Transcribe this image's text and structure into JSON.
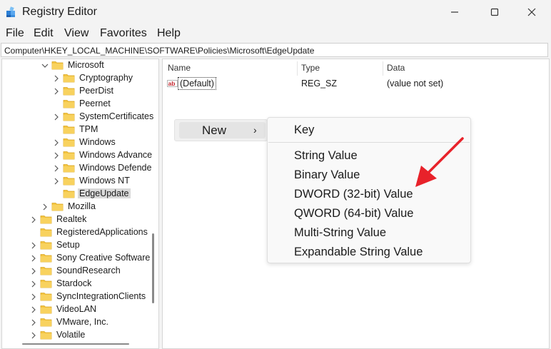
{
  "window": {
    "title": "Registry Editor",
    "icon": "registry-editor-icon"
  },
  "window_controls": {
    "minimize": "─",
    "maximize": "☐",
    "close": "✕"
  },
  "menubar": [
    "File",
    "Edit",
    "View",
    "Favorites",
    "Help"
  ],
  "address": "Computer\\HKEY_LOCAL_MACHINE\\SOFTWARE\\Policies\\Microsoft\\EdgeUpdate",
  "tree": [
    {
      "label": "Microsoft",
      "expanded": true,
      "level": 1
    },
    {
      "label": "Cryptography",
      "chevron": true,
      "level": 2
    },
    {
      "label": "PeerDist",
      "chevron": true,
      "level": 2
    },
    {
      "label": "Peernet",
      "chevron": false,
      "level": 2
    },
    {
      "label": "SystemCertificates",
      "chevron": true,
      "level": 2
    },
    {
      "label": "TPM",
      "chevron": false,
      "level": 2
    },
    {
      "label": "Windows",
      "chevron": true,
      "level": 2
    },
    {
      "label": "Windows Advance",
      "chevron": true,
      "level": 2
    },
    {
      "label": "Windows Defende",
      "chevron": true,
      "level": 2
    },
    {
      "label": "Windows NT",
      "chevron": true,
      "level": 2
    },
    {
      "label": "EdgeUpdate",
      "chevron": false,
      "level": 2,
      "selected": true
    },
    {
      "label": "Mozilla",
      "chevron": true,
      "level": 1
    },
    {
      "label": "Realtek",
      "chevron": true,
      "level": 0
    },
    {
      "label": "RegisteredApplications",
      "chevron": false,
      "level": 0
    },
    {
      "label": "Setup",
      "chevron": true,
      "level": 0
    },
    {
      "label": "Sony Creative Software",
      "chevron": true,
      "level": 0
    },
    {
      "label": "SoundResearch",
      "chevron": true,
      "level": 0
    },
    {
      "label": "Stardock",
      "chevron": true,
      "level": 0
    },
    {
      "label": "SyncIntegrationClients",
      "chevron": true,
      "level": 0
    },
    {
      "label": "VideoLAN",
      "chevron": true,
      "level": 0
    },
    {
      "label": "VMware, Inc.",
      "chevron": true,
      "level": 0
    },
    {
      "label": "Volatile",
      "chevron": true,
      "level": 0
    }
  ],
  "columns": {
    "name": "Name",
    "type": "Type",
    "data": "Data"
  },
  "values": [
    {
      "name": "(Default)",
      "type": "REG_SZ",
      "data": "(value not set)",
      "icon": "string-value-icon"
    }
  ],
  "context_menu": {
    "new_label": "New",
    "arrow": "›"
  },
  "new_submenu": [
    "Key",
    "String Value",
    "Binary Value",
    "DWORD (32-bit) Value",
    "QWORD (64-bit) Value",
    "Multi-String Value",
    "Expandable String Value"
  ],
  "colors": {
    "folder": "#f4c542",
    "annotation_arrow": "#e8222a",
    "selection": "#d9d9d9"
  }
}
